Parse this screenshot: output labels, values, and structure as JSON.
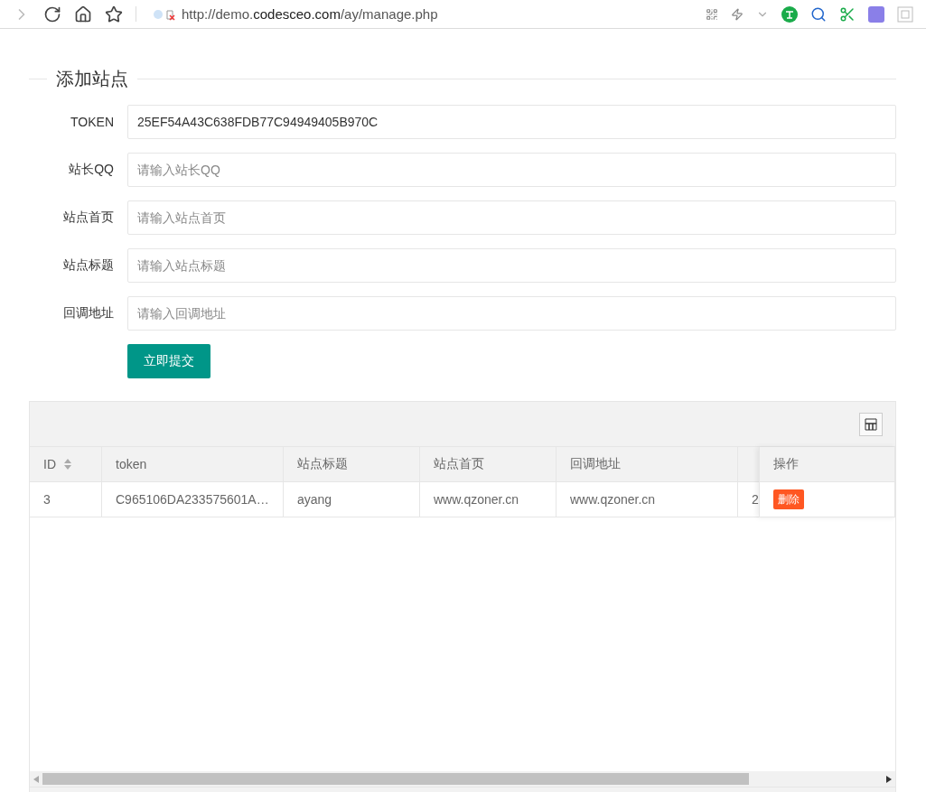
{
  "browser": {
    "url_prefix": "http://demo.",
    "url_domain": "codesceo.com",
    "url_path": "/ay/manage.php"
  },
  "form": {
    "title": "添加站点",
    "fields": [
      {
        "label": "TOKEN",
        "value": "25EF54A43C638FDB77C94949405B970C"
      },
      {
        "label": "站长QQ",
        "placeholder": "请输入站长QQ"
      },
      {
        "label": "站点首页",
        "placeholder": "请输入站点首页"
      },
      {
        "label": "站点标题",
        "placeholder": "请输入站点标题"
      },
      {
        "label": "回调地址",
        "placeholder": "请输入回调地址"
      }
    ],
    "submit": "立即提交"
  },
  "table": {
    "columns": [
      {
        "label": "ID",
        "sortable": true
      },
      {
        "label": "token",
        "sortable": false
      },
      {
        "label": "站点标题",
        "sortable": false
      },
      {
        "label": "站点首页",
        "sortable": false
      },
      {
        "label": "回调地址",
        "sortable": false
      }
    ],
    "fixed_column": "操作",
    "rows": [
      {
        "cells": [
          "3",
          "C965106DA233575601A…",
          "ayang",
          "www.qzoner.cn",
          "www.qzoner.cn",
          "2"
        ],
        "action": "删除"
      }
    ]
  }
}
